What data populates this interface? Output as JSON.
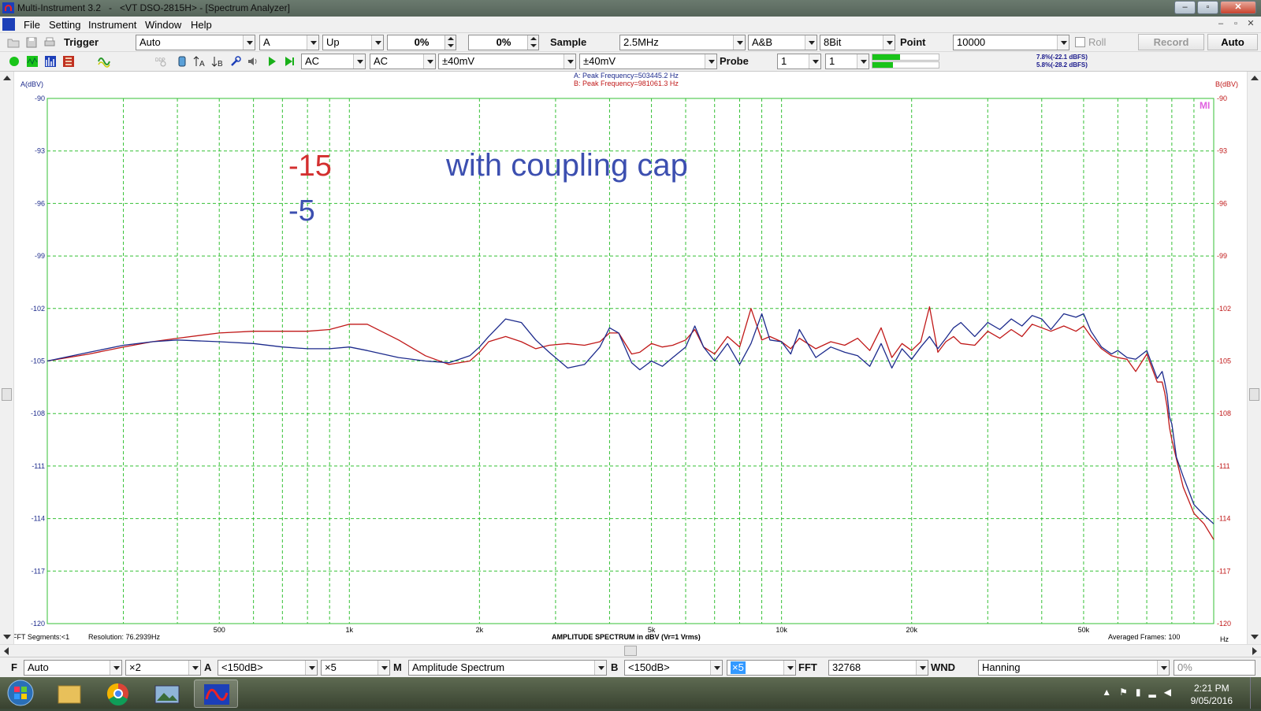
{
  "window": {
    "title": "Multi-Instrument 3.2   -   <VT DSO-2815H> - [Spectrum Analyzer]",
    "controls": [
      "–",
      "▫",
      "✕"
    ]
  },
  "menu": {
    "items": [
      "File",
      "Setting",
      "Instrument",
      "Window",
      "Help"
    ],
    "mdi_controls": [
      "–",
      "▫",
      "✕"
    ]
  },
  "toolbar1": {
    "trigger_label": "Trigger",
    "trigger_mode": "Auto",
    "trigger_channel": "A",
    "trigger_edge": "Up",
    "trigger_level": "0%",
    "trigger_delay": "0%",
    "sample_label": "Sample",
    "sample_rate": "2.5MHz",
    "channels": "A&B",
    "bits": "8Bit",
    "point_label": "Point",
    "points": "10000",
    "roll_label": "Roll",
    "record_label": "Record",
    "auto_label": "Auto"
  },
  "toolbar2": {
    "coupling_a": "AC",
    "coupling_b": "AC",
    "range_a": "±40mV",
    "range_b": "±40mV",
    "probe_label": "Probe",
    "probe_a": "1",
    "probe_b": "1",
    "meter_a_text": "7.8%(-22.1 dBFS)",
    "meter_b_text": "5.8%(-28.2 dBFS)",
    "meter_a_level": 0.42,
    "meter_b_level": 0.31
  },
  "colors": {
    "channel_a": "#1c2a8c",
    "channel_b": "#c01818",
    "grid": "#35c035",
    "overlay_red": "#d32f2f",
    "overlay_blue": "#3c4fb0"
  },
  "chart_data": {
    "type": "line",
    "title": "AMPLITUDE SPECTRUM in dBV (Vr=1 Vrms)",
    "ylabel_left": "A(dBV)",
    "ylabel_right": "B(dBV)",
    "xlabel": "Hz",
    "x_scale": "log",
    "xlim": [
      200,
      100000
    ],
    "ylim": [
      -120,
      -90
    ],
    "y_ticks": [
      -90,
      -93,
      -96,
      -99,
      -102,
      -105,
      -108,
      -111,
      -114,
      -117,
      -120
    ],
    "x_tick_labels": [
      {
        "value": 500,
        "label": "500"
      },
      {
        "value": 1000,
        "label": "1k"
      },
      {
        "value": 2000,
        "label": "2k"
      },
      {
        "value": 5000,
        "label": "5k"
      },
      {
        "value": 10000,
        "label": "10k"
      },
      {
        "value": 20000,
        "label": "20k"
      },
      {
        "value": 50000,
        "label": "50k"
      }
    ],
    "grid": true,
    "peak_a": "A: Peak Frequency=503445.2 Hz",
    "peak_b": "B: Peak Frequency=981061.3 Hz",
    "watermark": "MI",
    "footer_left_segments": "FFT Segments:<1",
    "footer_left_resolution": "Resolution: 76.2939Hz",
    "footer_right": "Averaged Frames: 100",
    "overlay_texts": {
      "red_value": "-15",
      "blue_value": "-5",
      "caption": "with coupling cap"
    },
    "series": [
      {
        "name": "A",
        "color": "#1c2a8c",
        "x": [
          200,
          250,
          300,
          350,
          400,
          500,
          600,
          700,
          800,
          900,
          1000,
          1100,
          1300,
          1500,
          1700,
          1900,
          2000,
          2100,
          2300,
          2500,
          2700,
          2900,
          3200,
          3500,
          3800,
          4000,
          4200,
          4500,
          4700,
          5000,
          5300,
          5600,
          6000,
          6300,
          6600,
          7000,
          7500,
          8000,
          8500,
          9000,
          9400,
          10000,
          10500,
          11000,
          12000,
          13000,
          14000,
          15000,
          16000,
          17000,
          18000,
          19000,
          20000,
          21000,
          22000,
          23000,
          24000,
          25000,
          26000,
          28000,
          30000,
          32000,
          34000,
          36000,
          38000,
          40000,
          42000,
          45000,
          48000,
          50000,
          52000,
          55000,
          58000,
          60000,
          63000,
          66000,
          70000,
          74000,
          76000,
          77000,
          78000,
          79000,
          80000,
          82000,
          85000,
          90000,
          95000,
          100000
        ],
        "y": [
          -105.0,
          -104.5,
          -104.1,
          -103.9,
          -103.8,
          -103.9,
          -104.0,
          -104.2,
          -104.3,
          -104.3,
          -104.2,
          -104.4,
          -104.8,
          -105.0,
          -105.1,
          -104.7,
          -104.2,
          -103.6,
          -102.6,
          -102.8,
          -103.8,
          -104.5,
          -105.4,
          -105.2,
          -104.2,
          -103.1,
          -103.4,
          -105.1,
          -105.5,
          -105.0,
          -105.3,
          -104.8,
          -104.2,
          -103.0,
          -104.2,
          -105.0,
          -104.0,
          -105.2,
          -104.0,
          -102.3,
          -103.8,
          -103.9,
          -104.6,
          -103.2,
          -104.8,
          -104.2,
          -104.5,
          -104.7,
          -105.3,
          -104.0,
          -105.4,
          -104.3,
          -104.9,
          -104.2,
          -103.6,
          -104.3,
          -103.7,
          -103.1,
          -102.8,
          -103.6,
          -102.8,
          -103.2,
          -102.6,
          -103.0,
          -102.4,
          -102.6,
          -103.2,
          -102.3,
          -102.5,
          -102.3,
          -103.3,
          -104.2,
          -104.6,
          -104.4,
          -104.8,
          -104.9,
          -104.4,
          -106.0,
          -105.6,
          -106.2,
          -106.9,
          -108.2,
          -108.6,
          -110.5,
          -111.6,
          -113.2,
          -113.8,
          -114.3
        ]
      },
      {
        "name": "B",
        "color": "#c01818",
        "x": [
          200,
          250,
          300,
          350,
          400,
          500,
          600,
          700,
          800,
          900,
          1000,
          1100,
          1300,
          1500,
          1700,
          1900,
          2000,
          2100,
          2300,
          2500,
          2700,
          2900,
          3200,
          3500,
          3800,
          4000,
          4200,
          4500,
          4700,
          5000,
          5300,
          5600,
          6000,
          6300,
          6600,
          7000,
          7500,
          8000,
          8500,
          9000,
          9400,
          10000,
          10500,
          11000,
          12000,
          13000,
          14000,
          15000,
          16000,
          17000,
          18000,
          19000,
          20000,
          21000,
          22000,
          23000,
          24000,
          25000,
          26000,
          28000,
          30000,
          32000,
          34000,
          36000,
          38000,
          40000,
          42000,
          45000,
          48000,
          50000,
          52000,
          55000,
          58000,
          60000,
          63000,
          66000,
          70000,
          74000,
          76000,
          77000,
          78000,
          79000,
          80000,
          82000,
          85000,
          90000,
          95000,
          100000
        ],
        "y": [
          -105.0,
          -104.6,
          -104.2,
          -103.9,
          -103.7,
          -103.4,
          -103.3,
          -103.3,
          -103.3,
          -103.2,
          -102.9,
          -102.9,
          -103.8,
          -104.7,
          -105.2,
          -105.0,
          -104.5,
          -103.9,
          -103.6,
          -103.9,
          -104.3,
          -104.1,
          -104.0,
          -104.1,
          -103.9,
          -103.4,
          -103.4,
          -104.6,
          -104.5,
          -104.0,
          -104.2,
          -104.1,
          -103.8,
          -103.2,
          -104.2,
          -104.6,
          -103.6,
          -104.2,
          -102.0,
          -103.8,
          -103.6,
          -103.9,
          -104.3,
          -103.7,
          -104.3,
          -103.9,
          -104.1,
          -103.7,
          -104.4,
          -103.1,
          -104.8,
          -104.0,
          -104.4,
          -103.9,
          -101.9,
          -104.5,
          -103.9,
          -103.6,
          -104.0,
          -104.1,
          -103.3,
          -103.7,
          -103.2,
          -103.6,
          -102.9,
          -103.1,
          -103.3,
          -103.0,
          -103.3,
          -103.0,
          -103.6,
          -104.3,
          -104.7,
          -104.8,
          -104.9,
          -105.6,
          -104.6,
          -106.2,
          -106.2,
          -106.8,
          -107.6,
          -108.8,
          -109.5,
          -110.6,
          -112.2,
          -113.7,
          -114.3,
          -115.2
        ]
      }
    ]
  },
  "bottombar": {
    "f_label": "F",
    "f_value": "Auto",
    "f_zoom": "×2",
    "a_label": "A",
    "a_range": "<150dB>",
    "a_zoom": "×5",
    "m_label": "M",
    "mode": "Amplitude Spectrum",
    "b_label": "B",
    "b_range": "<150dB>",
    "b_zoom": "×5",
    "fft_label": "FFT",
    "fft_size": "32768",
    "wnd_label": "WND",
    "window_fn": "Hanning",
    "overlap": "0%"
  },
  "taskbar": {
    "time": "2:21 PM",
    "date": "9/05/2016"
  }
}
